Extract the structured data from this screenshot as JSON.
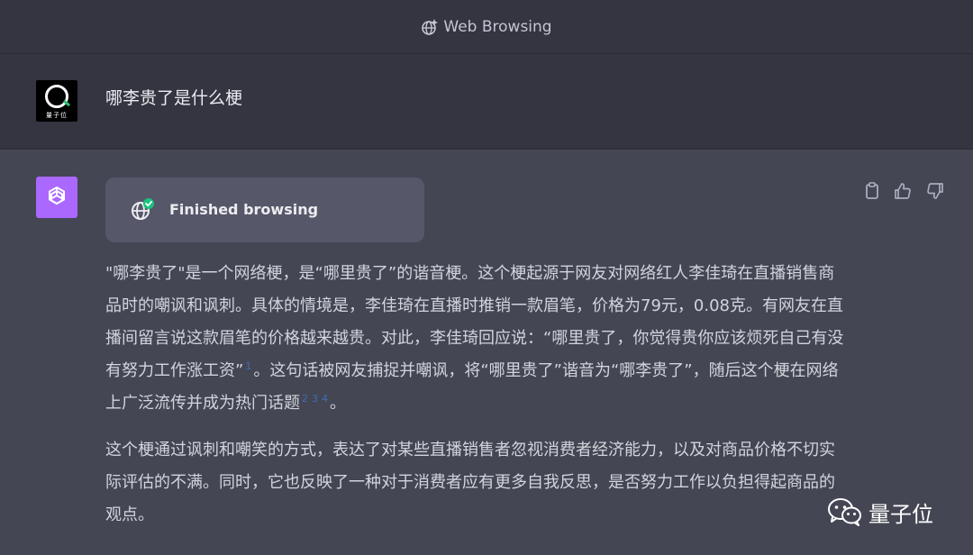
{
  "header": {
    "title": "Web Browsing",
    "icon": "plugin-globe-icon"
  },
  "conversation": {
    "user": {
      "avatar_icon": "quantum-bit-logo-icon",
      "avatar_text": "量子位",
      "message": "哪李贵了是什么梗"
    },
    "assistant": {
      "avatar_icon": "openai-logo-icon",
      "avatar_color": "#ab68ff",
      "browsing_status": "Finished browsing",
      "browsing_icon": "globe-check-icon",
      "actions": [
        {
          "name": "copy",
          "icon": "clipboard-icon"
        },
        {
          "name": "thumbs-up",
          "icon": "thumbs-up-icon"
        },
        {
          "name": "thumbs-down",
          "icon": "thumbs-down-icon"
        }
      ],
      "paragraph1": {
        "text_a": "\"哪李贵了\"是一个网络梗，是“哪里贵了”的谐音梗。这个梗起源于网友对网络红人李佳琦在直播销售商品时的嘲讽和讽刺。具体的情境是，李佳琦在直播时推销一款眉笔，价格为79元，0.08克。有网友在直播间留言说这款眉笔的价格越来越贵。对此，李佳琦回应说：“哪里贵了，你觉得贵你应该烦死自己有没有努力工作涨工资”",
        "cite1": "1",
        "text_b": "。这句话被网友捕捉并嘲讽，将“哪里贵了”谐音为“哪李贵了”，随后这个梗在网络上广泛流传并成为热门话题",
        "cite2": "2",
        "cite3": "3",
        "cite4": "4",
        "text_c": "。"
      },
      "paragraph2": "这个梗通过讽刺和嘲笑的方式，表达了对某些直播销售者忽视消费者经济能力，以及对商品价格不切实际评估的不满。同时，它也反映了一种对于消费者应有更多自我反思，是否努力工作以负担得起商品的观点。"
    }
  },
  "watermark": {
    "icon": "wechat-icon",
    "text": "量子位"
  }
}
